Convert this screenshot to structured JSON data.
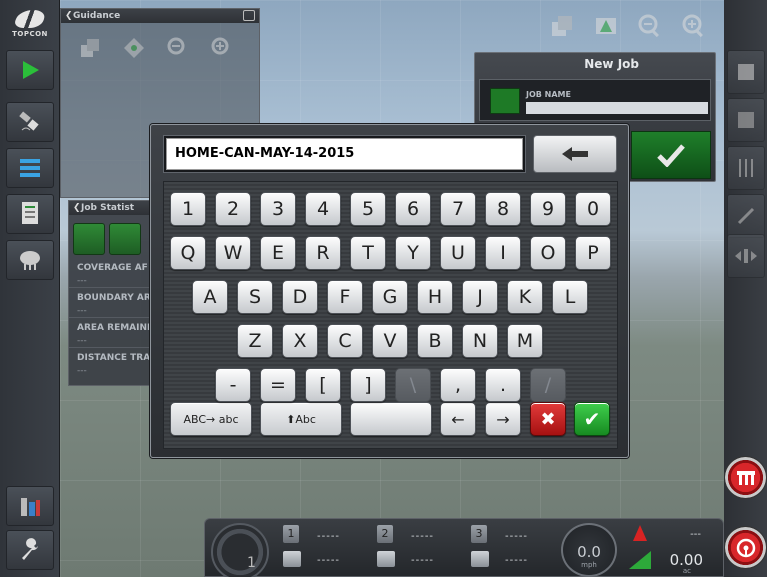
{
  "left_bar": {
    "logo_text": "TOPCON"
  },
  "guidance_panel": {
    "title": "Guidance"
  },
  "job_stats_panel": {
    "title": "Job Statist",
    "rows": [
      {
        "label": "COVERAGE AF",
        "value": "---"
      },
      {
        "label": "BOUNDARY AR",
        "value": "---"
      },
      {
        "label": "AREA REMAINI",
        "value": "---"
      },
      {
        "label": "DISTANCE TRA",
        "value": "---"
      }
    ]
  },
  "new_job_panel": {
    "title": "New Job",
    "field_label": "JOB NAME"
  },
  "keyboard": {
    "input_value": "HOME-CAN-MAY-14-2015",
    "row_numbers": [
      "1",
      "2",
      "3",
      "4",
      "5",
      "6",
      "7",
      "8",
      "9",
      "0"
    ],
    "row_q": [
      "Q",
      "W",
      "E",
      "R",
      "T",
      "Y",
      "U",
      "I",
      "O",
      "P"
    ],
    "row_a": [
      "A",
      "S",
      "D",
      "F",
      "G",
      "H",
      "J",
      "K",
      "L"
    ],
    "row_z": [
      "Z",
      "X",
      "C",
      "V",
      "B",
      "N",
      "M"
    ],
    "row_sym": [
      "-",
      "=",
      "[",
      "]",
      "\\",
      ",",
      ".",
      "/"
    ],
    "mode_label": "ABC→ abc",
    "shift_label": "⬆Abc",
    "space_label": "",
    "left_arrow": "←",
    "right_arrow": "→",
    "cancel_glyph": "✖",
    "ok_glyph": "✔",
    "backspace_glyph": "←"
  },
  "status_bar": {
    "section_numbers": [
      "1",
      "2",
      "3"
    ],
    "dash_value": "-----",
    "gauge_number": "1",
    "speed_value": "0.0",
    "speed_unit": "mph",
    "area_top": "---",
    "area_value": "0.00",
    "area_unit": "ac"
  },
  "colors": {
    "accent_green": "#1f7f2a",
    "cancel_red": "#c21d1d",
    "ok_green": "#2bb23a"
  }
}
